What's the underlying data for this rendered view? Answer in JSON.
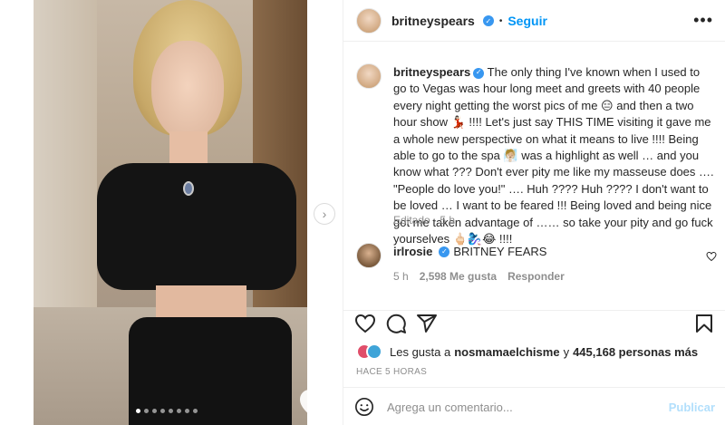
{
  "header": {
    "username": "britneyspears",
    "separator": "•",
    "follow_label": "Seguir",
    "more_label": "•••"
  },
  "caption": {
    "username": "britneyspears",
    "text": "The only thing I've known when I used to go to Vegas was hour long meet and greets with 40 people every night getting the worst pics of me 😑 and then a two hour show 💃🏻 !!!! Let's just say THIS TIME visiting it gave me a whole new perspective on what it means to live !!!! Being able to go to the spa 🧖🏼 was a highlight as well … and you know what ??? Don't ever pity me like my masseuse does …. \"People do love you!\" …. Huh ???? Huh ???? I don't want to be loved … I want to be feared !!! Being loved and being nice got me taken advantage of …… so take your pity and go fuck yourselves 🖕🏻🧞‍♀️😂 !!!!",
    "edited": "Editado",
    "time": "5 h"
  },
  "comment": {
    "username": "irlrosie",
    "text": "BRITNEY FEARS",
    "time": "5 h",
    "likes": "2,598 Me gusta",
    "reply_label": "Responder"
  },
  "likes": {
    "prefix": "Les gusta a",
    "user": "nosmamaelchisme",
    "conj": "y",
    "others": "445,168 personas más"
  },
  "timestamp": "HACE 5 HORAS",
  "add_comment": {
    "placeholder": "Agrega un comentario...",
    "publish_label": "Publicar"
  },
  "carousel": {
    "total_slides": 8,
    "active_index": 0
  },
  "colors": {
    "accent": "#0095f6",
    "verified": "#3897f0",
    "muted": "#8e8e8e",
    "publish_disabled": "#b2dffc"
  }
}
